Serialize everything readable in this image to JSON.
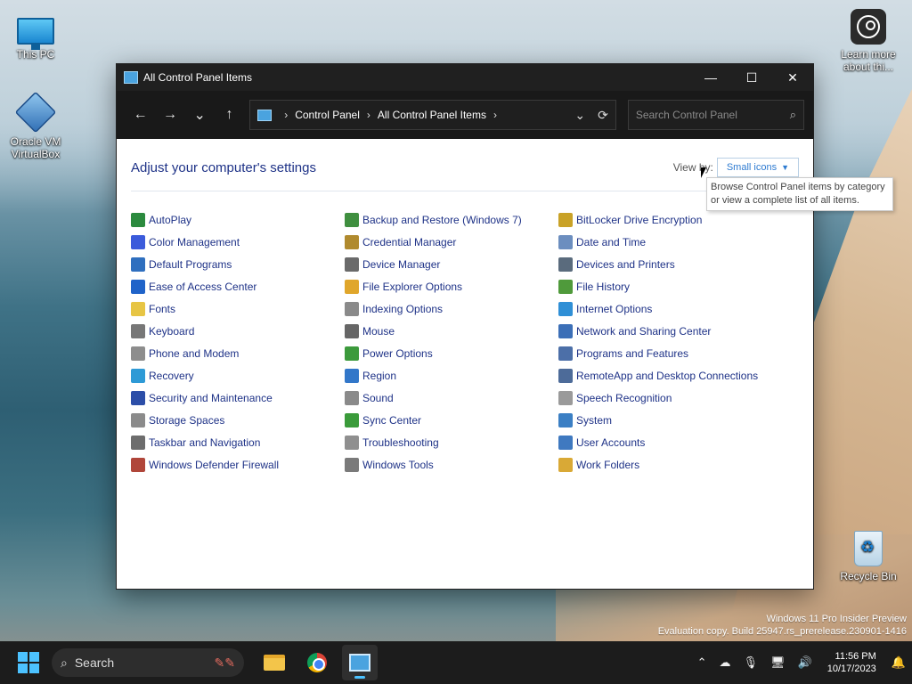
{
  "desktop": {
    "icons": [
      {
        "label": "This PC",
        "icon": "monitor-icon"
      },
      {
        "label": "Oracle VM VirtualBox",
        "icon": "virtualbox-icon"
      },
      {
        "label": "Learn more about thi...",
        "icon": "learn-more-icon"
      },
      {
        "label": "Recycle Bin",
        "icon": "recycle-bin-icon"
      }
    ],
    "watermark": {
      "line1": "Windows 11 Pro Insider Preview",
      "line2": "Evaluation copy. Build 25947.rs_prerelease.230901-1416"
    }
  },
  "window": {
    "title": "All Control Panel Items",
    "controls": {
      "minimize": "—",
      "maximize": "☐",
      "close": "✕"
    },
    "nav": {
      "back": "←",
      "forward": "→",
      "recent": "⌄",
      "up": "↑"
    },
    "address": {
      "crumbs": [
        "Control Panel",
        "All Control Panel Items"
      ],
      "separator": "›",
      "dropdown": "⌄",
      "refresh": "⟳"
    },
    "search": {
      "placeholder": "Search Control Panel",
      "value": ""
    },
    "heading": "Adjust your computer's settings",
    "view_by": {
      "label": "View by:",
      "selected": "Small icons"
    },
    "tooltip": "Browse Control Panel items by category or view a complete list of all items.",
    "items": [
      {
        "label": "AutoPlay",
        "color": "#2b8a3e"
      },
      {
        "label": "Backup and Restore (Windows 7)",
        "color": "#3f8f3f"
      },
      {
        "label": "BitLocker Drive Encryption",
        "color": "#c9a227"
      },
      {
        "label": "Color Management",
        "color": "#3b5bdb"
      },
      {
        "label": "Credential Manager",
        "color": "#b08a2e"
      },
      {
        "label": "Date and Time",
        "color": "#6c8ebf"
      },
      {
        "label": "Default Programs",
        "color": "#2f6fbf"
      },
      {
        "label": "Device Manager",
        "color": "#6a6a6a"
      },
      {
        "label": "Devices and Printers",
        "color": "#5a6b7d"
      },
      {
        "label": "Ease of Access Center",
        "color": "#1f63c9"
      },
      {
        "label": "File Explorer Options",
        "color": "#e0a62b"
      },
      {
        "label": "File History",
        "color": "#4f9a3b"
      },
      {
        "label": "Fonts",
        "color": "#e7c544"
      },
      {
        "label": "Indexing Options",
        "color": "#8a8a8a"
      },
      {
        "label": "Internet Options",
        "color": "#2f8fd6"
      },
      {
        "label": "Keyboard",
        "color": "#777777"
      },
      {
        "label": "Mouse",
        "color": "#666666"
      },
      {
        "label": "Network and Sharing Center",
        "color": "#3c6fb7"
      },
      {
        "label": "Phone and Modem",
        "color": "#8d8d8d"
      },
      {
        "label": "Power Options",
        "color": "#3c9a3c"
      },
      {
        "label": "Programs and Features",
        "color": "#4c6fa8"
      },
      {
        "label": "Recovery",
        "color": "#2e9ad6"
      },
      {
        "label": "Region",
        "color": "#3277c9"
      },
      {
        "label": "RemoteApp and Desktop Connections",
        "color": "#4d6b99"
      },
      {
        "label": "Security and Maintenance",
        "color": "#2c4ea8"
      },
      {
        "label": "Sound",
        "color": "#8a8a8a"
      },
      {
        "label": "Speech Recognition",
        "color": "#9a9a9a"
      },
      {
        "label": "Storage Spaces",
        "color": "#8b8b8b"
      },
      {
        "label": "Sync Center",
        "color": "#3a9b3a"
      },
      {
        "label": "System",
        "color": "#3b7fc4"
      },
      {
        "label": "Taskbar and Navigation",
        "color": "#6d6d6d"
      },
      {
        "label": "Troubleshooting",
        "color": "#8f8f8f"
      },
      {
        "label": "User Accounts",
        "color": "#3f79c0"
      },
      {
        "label": "Windows Defender Firewall",
        "color": "#b0463a"
      },
      {
        "label": "Windows Tools",
        "color": "#7a7a7a"
      },
      {
        "label": "Work Folders",
        "color": "#d9a936"
      }
    ]
  },
  "taskbar": {
    "search_label": "Search",
    "apps": [
      "File Explorer",
      "Google Chrome",
      "Control Panel"
    ],
    "tray": {
      "overflow": "⌃",
      "onedrive": "☁",
      "mic": "🎙",
      "network": "🖥",
      "volume": "🔊",
      "notifications": "🔔"
    },
    "time": "11:56 PM",
    "date": "10/17/2023"
  }
}
